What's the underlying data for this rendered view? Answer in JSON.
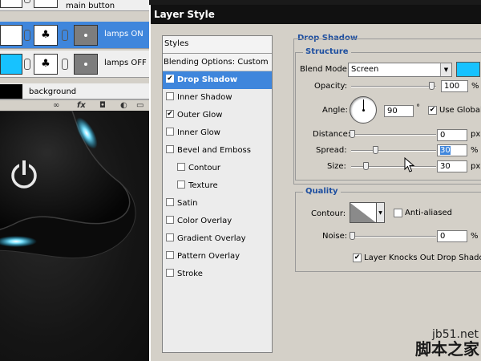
{
  "layers": {
    "top_row_name": "main button",
    "lamps_on_name": "lamps ON",
    "lamps_off_name": "lamps OFF",
    "background_name": "background",
    "fx_label": "fx"
  },
  "dialog": {
    "title": "Layer Style",
    "styles_header": "Styles",
    "blending_options": "Blending Options: Custom",
    "effects": [
      {
        "label": "Drop Shadow",
        "checked": true
      },
      {
        "label": "Inner Shadow",
        "checked": false
      },
      {
        "label": "Outer Glow",
        "checked": true
      },
      {
        "label": "Inner Glow",
        "checked": false
      },
      {
        "label": "Bevel and Emboss",
        "checked": false
      },
      {
        "label": "Contour",
        "checked": false
      },
      {
        "label": "Texture",
        "checked": false
      },
      {
        "label": "Satin",
        "checked": false
      },
      {
        "label": "Color Overlay",
        "checked": false
      },
      {
        "label": "Gradient Overlay",
        "checked": false
      },
      {
        "label": "Pattern Overlay",
        "checked": false
      },
      {
        "label": "Stroke",
        "checked": false
      }
    ]
  },
  "drop_shadow": {
    "section_title": "Drop Shadow",
    "structure_title": "Structure",
    "blend_mode_label": "Blend Mode:",
    "blend_mode_value": "Screen",
    "shadow_color": "#17c2ff",
    "opacity_label": "Opacity:",
    "opacity_value": "100",
    "angle_label": "Angle:",
    "angle_value": "90",
    "degree_symbol": "°",
    "use_global_light_label": "Use Global L",
    "use_global_light_checked": true,
    "distance_label": "Distance:",
    "distance_value": "0",
    "spread_label": "Spread:",
    "spread_value": "30",
    "size_label": "Size:",
    "size_value": "30",
    "unit_percent": "%",
    "unit_px": "px"
  },
  "quality": {
    "title": "Quality",
    "contour_label": "Contour:",
    "anti_aliased_label": "Anti-aliased",
    "noise_label": "Noise:",
    "noise_value": "0",
    "knocks_out_label": "Layer Knocks Out Drop Shadow",
    "knocks_out_checked": true
  },
  "watermark": {
    "site": "jb51.net",
    "brand": "脚本之家"
  }
}
